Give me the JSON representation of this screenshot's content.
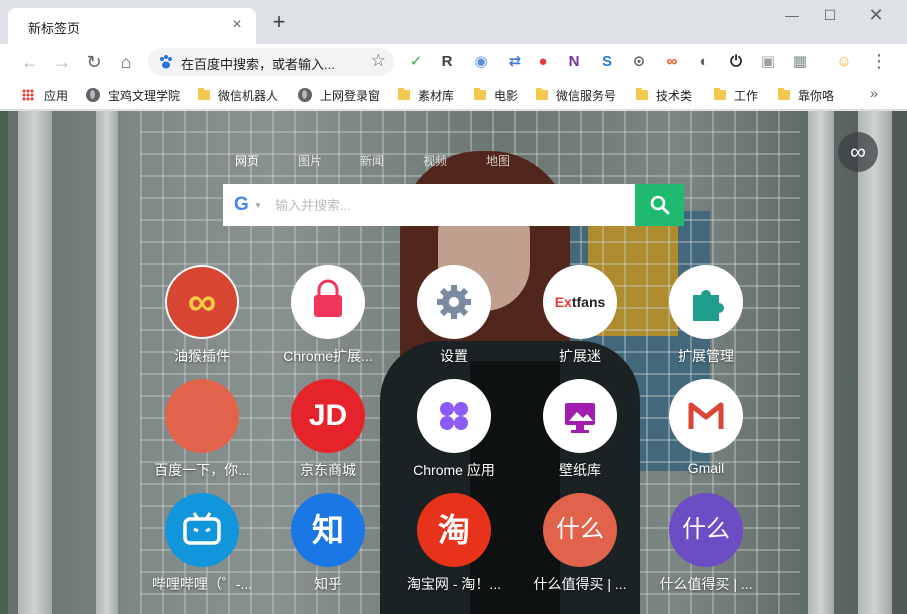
{
  "browser": {
    "tab_title": "新标签页",
    "tab_close": "×",
    "new_tab": "+",
    "window_min": "—",
    "window_max": "☐",
    "window_close": "✕"
  },
  "toolbar": {
    "back": "←",
    "forward": "→",
    "reload": "↻",
    "home": "⌂",
    "omnibox_text": "在百度中搜索，或者输入...",
    "star": "☆",
    "menu": "⋮",
    "extensions": [
      {
        "name": "shield-extension-icon",
        "text": "✓",
        "color": "#34a853"
      },
      {
        "name": "r-extension-icon",
        "text": "R",
        "color": "#3c4043"
      },
      {
        "name": "owl-extension-icon",
        "text": "◉",
        "color": "#5b8fd8"
      },
      {
        "name": "proxy-extension-icon",
        "text": "⇄",
        "color": "#4a7bd0"
      },
      {
        "name": "red-drop-extension-icon",
        "text": "●",
        "color": "#e53935"
      },
      {
        "name": "onenote-extension-icon",
        "text": "N",
        "color": "#7b2fa0"
      },
      {
        "name": "s-extension-icon",
        "text": "S",
        "color": "#2b7cd3"
      },
      {
        "name": "screenshot-extension-icon",
        "text": "⊙",
        "color": "#5f6368"
      },
      {
        "name": "tampermonkey-extension-icon",
        "text": "∞",
        "color": "#e8501f"
      },
      {
        "name": "incognito-extension-icon",
        "text": "◐",
        "color": "#5f6368"
      },
      {
        "name": "power-extension-icon",
        "text": "⏻",
        "color": "#202124"
      },
      {
        "name": "camera-extension-icon",
        "text": "▣",
        "color": "#9aa0a6"
      },
      {
        "name": "gallery-extension-icon",
        "text": "▦",
        "color": "#7f8c8d"
      },
      {
        "name": "profile-avatar-icon",
        "text": "☺",
        "color": "#f4b400"
      }
    ]
  },
  "bookmarks": [
    {
      "label": "应用",
      "type": "apps"
    },
    {
      "label": "宝鸡文理学院",
      "type": "site"
    },
    {
      "label": "微信机器人",
      "type": "folder"
    },
    {
      "label": "上网登录窗",
      "type": "site"
    },
    {
      "label": "素材库",
      "type": "folder"
    },
    {
      "label": "电影",
      "type": "folder"
    },
    {
      "label": "微信服务号",
      "type": "folder"
    },
    {
      "label": "技术类",
      "type": "folder"
    },
    {
      "label": "工作",
      "type": "folder"
    },
    {
      "label": "靠你咯",
      "type": "folder"
    }
  ],
  "bookmarks_more": "»",
  "newtab": {
    "infinity_label": "∞",
    "search_tabs": [
      "网页",
      "图片",
      "新闻",
      "视频",
      "地图"
    ],
    "search_placeholder": "输入并搜索...",
    "search_engine_logo": "G",
    "tiles": [
      {
        "label": "油猴插件",
        "name": "tile-tampermonkey",
        "color": "#d84532",
        "glyph": "∞",
        "glyph_color": "#f7c948"
      },
      {
        "label": "Chrome扩展...",
        "name": "tile-chrome-extensions",
        "color": "#ffffff",
        "glyph": "bag",
        "glyph_color": "#f2355b"
      },
      {
        "label": "设置",
        "name": "tile-settings",
        "color": "#ffffff",
        "glyph": "gear",
        "glyph_color": "#7a8aa0"
      },
      {
        "label": "扩展迷",
        "name": "tile-extfans",
        "color": "#ffffff",
        "glyph": "Extfans",
        "glyph_color": "#222222"
      },
      {
        "label": "扩展管理",
        "name": "tile-extension-manager",
        "color": "#ffffff",
        "glyph": "puzzle",
        "glyph_color": "#1f9e8c"
      },
      {
        "label": "百度一下，你...",
        "name": "tile-baidu",
        "color": "#e2634b",
        "glyph": "",
        "glyph_color": "#ffffff"
      },
      {
        "label": "京东商城",
        "name": "tile-jd",
        "color": "#e4232b",
        "glyph": "JD",
        "glyph_color": "#ffffff"
      },
      {
        "label": "Chrome 应用",
        "name": "tile-chrome-apps",
        "color": "#ffffff",
        "glyph": "apps",
        "glyph_color": "#8b5cf6"
      },
      {
        "label": "壁纸库",
        "name": "tile-wallpaper",
        "color": "#ffffff",
        "glyph": "wallpaper",
        "glyph_color": "#a21caf"
      },
      {
        "label": "Gmail",
        "name": "tile-gmail",
        "color": "#ffffff",
        "glyph": "M",
        "glyph_color": "#db4437"
      },
      {
        "label": "哔哩哔哩（゜-...",
        "name": "tile-bilibili",
        "color": "#1296db",
        "glyph": "tv",
        "glyph_color": "#ffffff"
      },
      {
        "label": "知乎",
        "name": "tile-zhihu",
        "color": "#1a77e4",
        "glyph": "知",
        "glyph_color": "#ffffff"
      },
      {
        "label": "淘宝网 - 淘！...",
        "name": "tile-taobao",
        "color": "#e8331c",
        "glyph": "淘",
        "glyph_color": "#ffffff"
      },
      {
        "label": "什么值得买 | ...",
        "name": "tile-smzdm-1",
        "color": "#e2634b",
        "glyph": "什么",
        "glyph_color": "#ffffff"
      },
      {
        "label": "什么值得买 | ...",
        "name": "tile-smzdm-2",
        "color": "#6c4dc4",
        "glyph": "什么",
        "glyph_color": "#ffffff"
      }
    ]
  }
}
